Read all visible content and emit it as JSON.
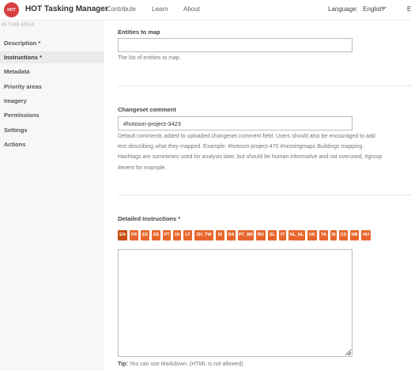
{
  "header": {
    "logo_text": "HOT",
    "brand": "HOT Tasking Manager",
    "nav": [
      "Contribute",
      "Learn",
      "About"
    ],
    "language_label": "Language:",
    "language_value": "English",
    "edge_letter": "E"
  },
  "sidebar": {
    "caption": "IN THIS AREA",
    "items": [
      {
        "label": "Description *"
      },
      {
        "label": "Instructions *"
      },
      {
        "label": "Metadata"
      },
      {
        "label": "Priority areas"
      },
      {
        "label": "Imagery"
      },
      {
        "label": "Permissions"
      },
      {
        "label": "Settings"
      },
      {
        "label": "Actions"
      }
    ],
    "active_index": 1
  },
  "entities": {
    "label": "Entities to map",
    "value": "",
    "help": "The list of entities to map."
  },
  "changeset": {
    "label": "Changeset comment",
    "value": "#hotosm-project-3423",
    "help_lines": [
      "Default comments added to uploaded changeset comment field. Users should also be encouraged to add",
      "text describing what they mapped. Example: #hotosm-project-470 #missingmaps Buildings mapping.",
      "Hashtags are sometimes used for analysis later, but should be human informative and not overused, #group",
      "#event for example."
    ]
  },
  "instructions": {
    "label": "Detailed Instructions *",
    "languages": [
      "EN",
      "FR",
      "ES",
      "DE",
      "PT",
      "JA",
      "LT",
      "ZH_TW",
      "ID",
      "DA",
      "PT_BR",
      "RU",
      "SL",
      "IT",
      "NL_NL",
      "UK",
      "TA",
      "SI",
      "CS",
      "NB",
      "HU"
    ],
    "active_language": "EN",
    "value": "",
    "tip_bold": "Tip:",
    "tip_text": " You can use Markdown. (HTML is not allowed)"
  },
  "colors": {
    "tab": "#e8662c",
    "tab_active": "#c74e14",
    "logo": "#d73f3f"
  }
}
